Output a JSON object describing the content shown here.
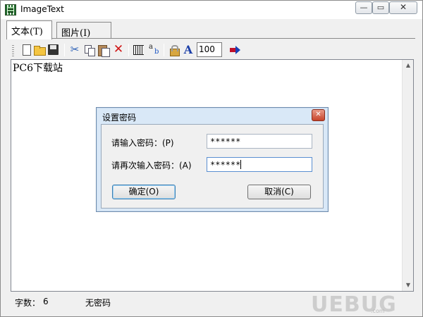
{
  "window": {
    "title": "ImageText",
    "controls": {
      "minimize": "—",
      "maximize": "▭",
      "close": "✕"
    }
  },
  "tabs": [
    {
      "label": "文本(T)",
      "active": true
    },
    {
      "label": "图片(I)",
      "active": false
    }
  ],
  "toolbar": {
    "icons": [
      "new-file-icon",
      "open-folder-icon",
      "save-icon",
      "cut-icon",
      "copy-icon",
      "paste-icon",
      "delete-icon",
      "grid-icon",
      "replace-icon",
      "lock-icon",
      "font-icon",
      "go-arrow-icon"
    ],
    "cut_glyph": "✂",
    "delete_glyph": "✕",
    "font_glyph": "A",
    "zoom_value": "100"
  },
  "editor": {
    "text": "PC6下载站",
    "scroll_up": "▲",
    "scroll_down": "▼"
  },
  "status": {
    "char_label": "字数：",
    "char_count": "6",
    "password_state": "无密码"
  },
  "watermark": {
    "text": "UEBUG",
    "sub": ".com"
  },
  "dialog": {
    "title": "设置密码",
    "close_glyph": "✕",
    "password_label": "请输入密码：(P)",
    "password_value": "******",
    "confirm_label": "请再次输入密码：(A)",
    "confirm_value": "******",
    "ok_label": "确定(O)",
    "cancel_label": "取消(C)"
  },
  "colors": {
    "dialog_frame": "#d9e8f7",
    "close_button": "#c7432a",
    "accent_blue": "#3c7fb1"
  }
}
